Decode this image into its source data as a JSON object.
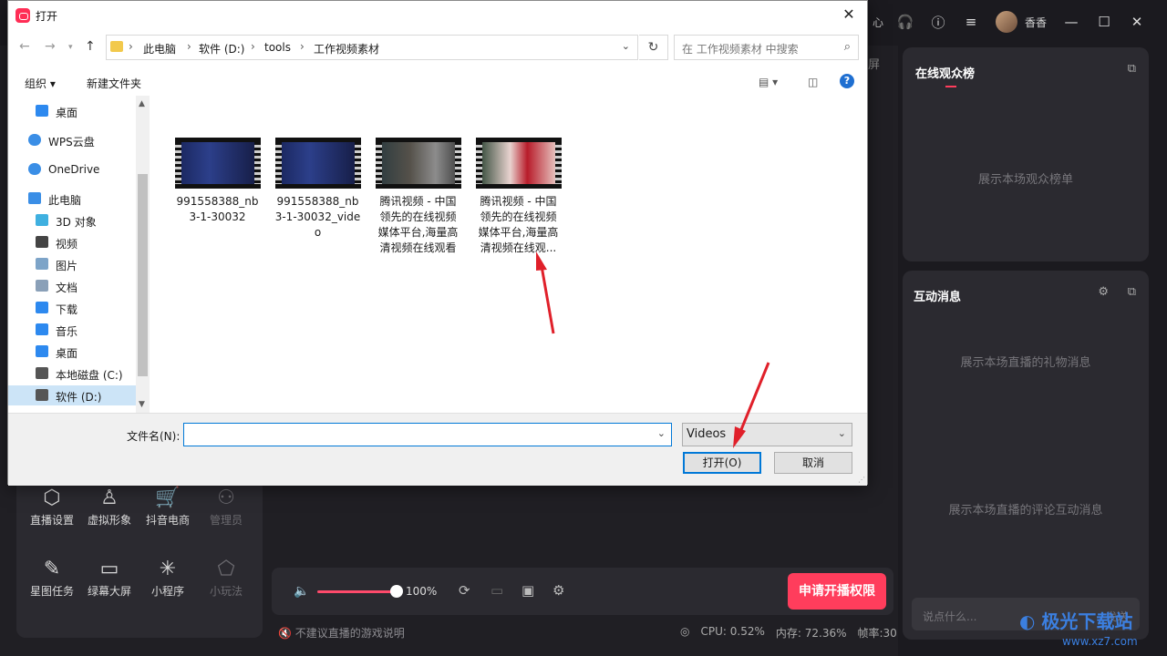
{
  "app": {
    "username": "香香",
    "top_partial_text": "心",
    "screen_partial": "屏",
    "tools": [
      {
        "label": "直播设置",
        "icon": "⬡"
      },
      {
        "label": "虚拟形象",
        "icon": "♙"
      },
      {
        "label": "抖音电商",
        "icon": "🛒"
      },
      {
        "label": "管理员",
        "icon": "⚇"
      },
      {
        "label": "星图任务",
        "icon": "✎"
      },
      {
        "label": "绿幕大屏",
        "icon": "▭"
      },
      {
        "label": "小程序",
        "icon": "✳"
      },
      {
        "label": "小玩法",
        "icon": "⬠"
      }
    ],
    "volume": {
      "percent_label": "100%",
      "level": 1.0
    },
    "apply_button": "申请开播权限",
    "status_left": "不建议直播的游戏说明",
    "cpu": "CPU: 0.52%",
    "memory": "内存: 72.36%",
    "framerate": "帧率:30",
    "audience_card": {
      "title": "在线观众榜",
      "hint": "展示本场观众榜单"
    },
    "interaction_card": {
      "title": "互动消息",
      "gift_hint": "展示本场直播的礼物消息",
      "comment_hint": "展示本场直播的评论互动消息"
    },
    "chat": {
      "placeholder": "说点什么...",
      "send": "发送"
    },
    "watermark": {
      "brand": "极光下载站",
      "url": "www.xz7.com"
    }
  },
  "dialog": {
    "title": "打开",
    "breadcrumb": [
      "此电脑",
      "软件 (D:)",
      "tools",
      "工作视频素材"
    ],
    "search_placeholder": "在 工作视频素材 中搜索",
    "toolbar": {
      "organize": "组织 ▾",
      "new_folder": "新建文件夹",
      "help": "?"
    },
    "nav_items": [
      {
        "label": "桌面",
        "icon": "desktop"
      },
      {
        "label": "WPS云盘",
        "icon": "cloud"
      },
      {
        "label": "OneDrive",
        "icon": "cloud"
      },
      {
        "label": "此电脑",
        "icon": "computer"
      },
      {
        "label": "3D 对象",
        "icon": "cube"
      },
      {
        "label": "视频",
        "icon": "video"
      },
      {
        "label": "图片",
        "icon": "picture"
      },
      {
        "label": "文档",
        "icon": "document"
      },
      {
        "label": "下载",
        "icon": "download"
      },
      {
        "label": "音乐",
        "icon": "music"
      },
      {
        "label": "桌面",
        "icon": "desktop"
      },
      {
        "label": "本地磁盘 (C:)",
        "icon": "drive"
      },
      {
        "label": "软件 (D:)",
        "icon": "drive",
        "selected": true
      }
    ],
    "files": [
      {
        "name": "991558388_nb3-1-30032"
      },
      {
        "name": "991558388_nb3-1-30032_video"
      },
      {
        "name": "腾讯视频 - 中国领先的在线视频媒体平台,海量高清视频在线观看"
      },
      {
        "name": "腾讯视频 - 中国领先的在线视频媒体平台,海量高清视频在线观..."
      }
    ],
    "filename_label": "文件名(N):",
    "filename_value": "",
    "file_type": "Videos",
    "open_button": "打开(O)",
    "cancel_button": "取消"
  }
}
